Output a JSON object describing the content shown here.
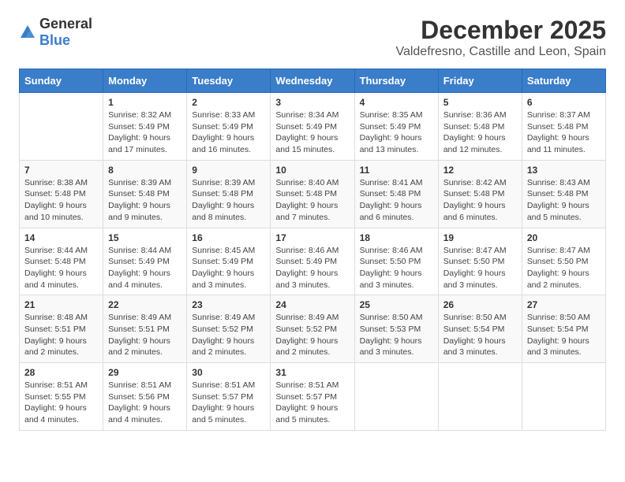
{
  "logo": {
    "general": "General",
    "blue": "Blue"
  },
  "title": "December 2025",
  "subtitle": "Valdefresno, Castille and Leon, Spain",
  "columns": [
    "Sunday",
    "Monday",
    "Tuesday",
    "Wednesday",
    "Thursday",
    "Friday",
    "Saturday"
  ],
  "weeks": [
    [
      {
        "day": "",
        "info": ""
      },
      {
        "day": "1",
        "info": "Sunrise: 8:32 AM\nSunset: 5:49 PM\nDaylight: 9 hours\nand 17 minutes."
      },
      {
        "day": "2",
        "info": "Sunrise: 8:33 AM\nSunset: 5:49 PM\nDaylight: 9 hours\nand 16 minutes."
      },
      {
        "day": "3",
        "info": "Sunrise: 8:34 AM\nSunset: 5:49 PM\nDaylight: 9 hours\nand 15 minutes."
      },
      {
        "day": "4",
        "info": "Sunrise: 8:35 AM\nSunset: 5:49 PM\nDaylight: 9 hours\nand 13 minutes."
      },
      {
        "day": "5",
        "info": "Sunrise: 8:36 AM\nSunset: 5:48 PM\nDaylight: 9 hours\nand 12 minutes."
      },
      {
        "day": "6",
        "info": "Sunrise: 8:37 AM\nSunset: 5:48 PM\nDaylight: 9 hours\nand 11 minutes."
      }
    ],
    [
      {
        "day": "7",
        "info": "Sunrise: 8:38 AM\nSunset: 5:48 PM\nDaylight: 9 hours\nand 10 minutes."
      },
      {
        "day": "8",
        "info": "Sunrise: 8:39 AM\nSunset: 5:48 PM\nDaylight: 9 hours\nand 9 minutes."
      },
      {
        "day": "9",
        "info": "Sunrise: 8:39 AM\nSunset: 5:48 PM\nDaylight: 9 hours\nand 8 minutes."
      },
      {
        "day": "10",
        "info": "Sunrise: 8:40 AM\nSunset: 5:48 PM\nDaylight: 9 hours\nand 7 minutes."
      },
      {
        "day": "11",
        "info": "Sunrise: 8:41 AM\nSunset: 5:48 PM\nDaylight: 9 hours\nand 6 minutes."
      },
      {
        "day": "12",
        "info": "Sunrise: 8:42 AM\nSunset: 5:48 PM\nDaylight: 9 hours\nand 6 minutes."
      },
      {
        "day": "13",
        "info": "Sunrise: 8:43 AM\nSunset: 5:48 PM\nDaylight: 9 hours\nand 5 minutes."
      }
    ],
    [
      {
        "day": "14",
        "info": "Sunrise: 8:44 AM\nSunset: 5:48 PM\nDaylight: 9 hours\nand 4 minutes."
      },
      {
        "day": "15",
        "info": "Sunrise: 8:44 AM\nSunset: 5:49 PM\nDaylight: 9 hours\nand 4 minutes."
      },
      {
        "day": "16",
        "info": "Sunrise: 8:45 AM\nSunset: 5:49 PM\nDaylight: 9 hours\nand 3 minutes."
      },
      {
        "day": "17",
        "info": "Sunrise: 8:46 AM\nSunset: 5:49 PM\nDaylight: 9 hours\nand 3 minutes."
      },
      {
        "day": "18",
        "info": "Sunrise: 8:46 AM\nSunset: 5:50 PM\nDaylight: 9 hours\nand 3 minutes."
      },
      {
        "day": "19",
        "info": "Sunrise: 8:47 AM\nSunset: 5:50 PM\nDaylight: 9 hours\nand 3 minutes."
      },
      {
        "day": "20",
        "info": "Sunrise: 8:47 AM\nSunset: 5:50 PM\nDaylight: 9 hours\nand 2 minutes."
      }
    ],
    [
      {
        "day": "21",
        "info": "Sunrise: 8:48 AM\nSunset: 5:51 PM\nDaylight: 9 hours\nand 2 minutes."
      },
      {
        "day": "22",
        "info": "Sunrise: 8:49 AM\nSunset: 5:51 PM\nDaylight: 9 hours\nand 2 minutes."
      },
      {
        "day": "23",
        "info": "Sunrise: 8:49 AM\nSunset: 5:52 PM\nDaylight: 9 hours\nand 2 minutes."
      },
      {
        "day": "24",
        "info": "Sunrise: 8:49 AM\nSunset: 5:52 PM\nDaylight: 9 hours\nand 2 minutes."
      },
      {
        "day": "25",
        "info": "Sunrise: 8:50 AM\nSunset: 5:53 PM\nDaylight: 9 hours\nand 3 minutes."
      },
      {
        "day": "26",
        "info": "Sunrise: 8:50 AM\nSunset: 5:54 PM\nDaylight: 9 hours\nand 3 minutes."
      },
      {
        "day": "27",
        "info": "Sunrise: 8:50 AM\nSunset: 5:54 PM\nDaylight: 9 hours\nand 3 minutes."
      }
    ],
    [
      {
        "day": "28",
        "info": "Sunrise: 8:51 AM\nSunset: 5:55 PM\nDaylight: 9 hours\nand 4 minutes."
      },
      {
        "day": "29",
        "info": "Sunrise: 8:51 AM\nSunset: 5:56 PM\nDaylight: 9 hours\nand 4 minutes."
      },
      {
        "day": "30",
        "info": "Sunrise: 8:51 AM\nSunset: 5:57 PM\nDaylight: 9 hours\nand 5 minutes."
      },
      {
        "day": "31",
        "info": "Sunrise: 8:51 AM\nSunset: 5:57 PM\nDaylight: 9 hours\nand 5 minutes."
      },
      {
        "day": "",
        "info": ""
      },
      {
        "day": "",
        "info": ""
      },
      {
        "day": "",
        "info": ""
      }
    ]
  ]
}
